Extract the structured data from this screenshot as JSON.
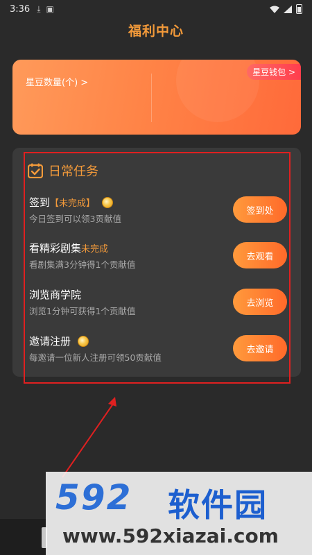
{
  "status_bar": {
    "time": "3:36",
    "icons": [
      "download-icon",
      "shield-icon"
    ],
    "right_icons": [
      "wifi-icon",
      "signal-icon",
      "battery-icon"
    ]
  },
  "page": {
    "title": "福利中心"
  },
  "stardou_card": {
    "count_label": "星豆数量(个) >",
    "wallet_label": "星豆钱包 >"
  },
  "tasks": {
    "title": "日常任务",
    "items": [
      {
        "name": "签到",
        "status": "【未完成】",
        "coin": true,
        "desc": "今日签到可以领3贡献值",
        "button": "签到处"
      },
      {
        "name": "看精彩剧集",
        "status": "未完成",
        "coin": false,
        "desc": "看剧集满3分钟得1个贡献值",
        "button": "去观看"
      },
      {
        "name": "浏览商学院",
        "status": "",
        "coin": false,
        "desc": "浏览1分钟可获得1个贡献值",
        "button": "去浏览"
      },
      {
        "name": "邀请注册",
        "status": "",
        "coin": true,
        "desc": "每邀请一位新人注册可领50贡献值",
        "button": "去邀请"
      }
    ]
  },
  "watermark": {
    "logo_num": "592",
    "logo_cn": "软件园",
    "url": "www.592xiazai.com"
  },
  "colors": {
    "accent_orange": "#f39a3a",
    "panel_bg": "#3a3a3a",
    "page_bg": "#2a2a2a",
    "highlight_red": "#e02020"
  }
}
